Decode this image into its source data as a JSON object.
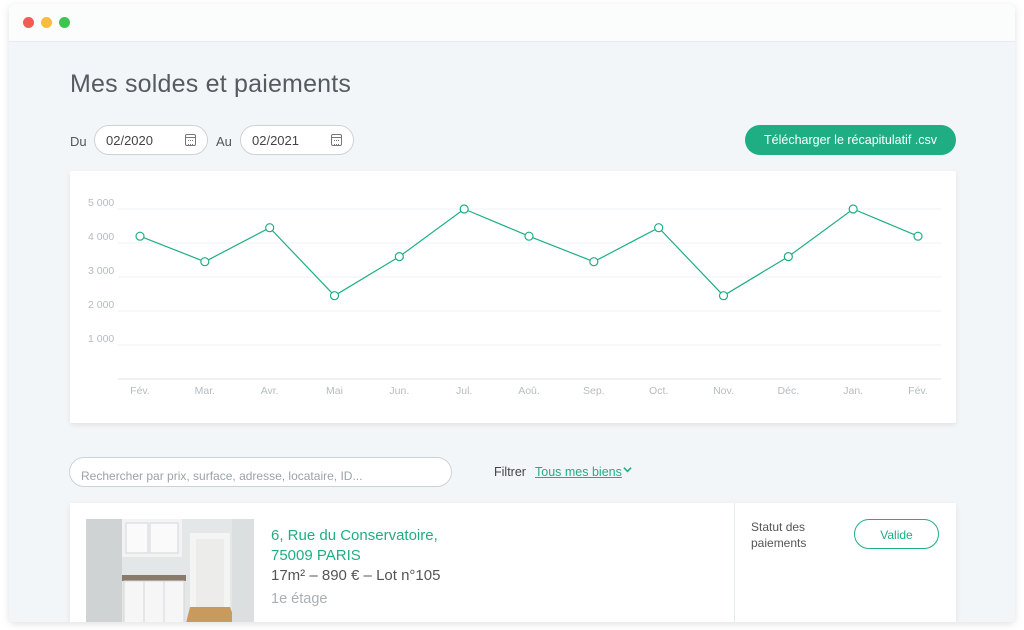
{
  "window": {
    "controls": [
      "close",
      "minimize",
      "zoom"
    ]
  },
  "page": {
    "title": "Mes soldes et paiements"
  },
  "filters": {
    "from_label": "Du",
    "from_value": "02/2020",
    "to_label": "Au",
    "to_value": "02/2021",
    "calendar_icon": "calendar-icon"
  },
  "download": {
    "label": "Télécharger le récapitulatif .csv"
  },
  "colors": {
    "accent": "#1fae84",
    "background": "#f3f6f8",
    "grid": "#e8ecee"
  },
  "chart_data": {
    "type": "line",
    "categories": [
      "Fév.",
      "Mar.",
      "Avr.",
      "Mai",
      "Jun.",
      "Jul.",
      "Aoû.",
      "Sep.",
      "Oct.",
      "Nov.",
      "Déc.",
      "Jan.",
      "Fév."
    ],
    "series": [
      {
        "values": [
          4200,
          3450,
          4450,
          2450,
          3600,
          5000,
          4200,
          3450,
          4450,
          2450,
          3600,
          5000,
          4200
        ]
      }
    ],
    "yticks": [
      "1 000",
      "2 000",
      "3 000",
      "4 000",
      "5 000"
    ],
    "ylim": [
      0,
      5000
    ],
    "grid": true,
    "title": "",
    "xlabel": "",
    "ylabel": ""
  },
  "search": {
    "placeholder": "Rechercher par prix, surface, adresse, locataire, ID..."
  },
  "filter": {
    "label": "Filtrer",
    "value": "Tous mes biens"
  },
  "property": {
    "address_line1": "6, Rue du Conservatoire,",
    "address_line2": "75009 PARIS",
    "specs": "17m² – 890 € – Lot n°105",
    "floor": "1e étage",
    "status_label": "Statut des paiements",
    "status_value": "Valide"
  }
}
